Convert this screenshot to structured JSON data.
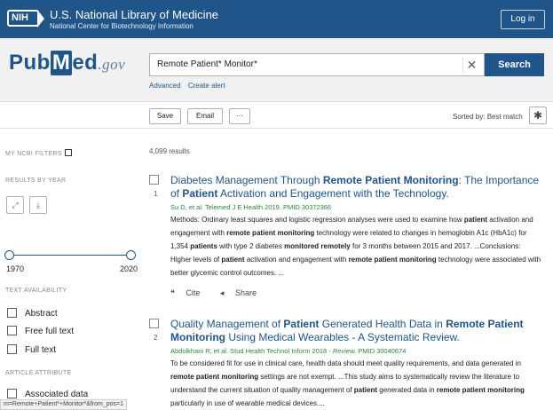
{
  "header": {
    "badge": "NIH",
    "org_title": "U.S. National Library of Medicine",
    "org_subtitle": "National Center for Biotechnology Information",
    "login_label": "Log in"
  },
  "pubmed": {
    "logo_pub": "Pub",
    "logo_m": "M",
    "logo_ed": "ed",
    "logo_gov": ".gov"
  },
  "search": {
    "query": "Remote Patient* Monitor*",
    "clear_glyph": "✕",
    "button_label": "Search",
    "advanced_label": "Advanced",
    "create_alert_label": "Create alert"
  },
  "toolbar": {
    "save_label": "Save",
    "email_label": "Email",
    "more_label": "···",
    "sort_text": "Sorted by: Best match",
    "gear_glyph": "✱"
  },
  "sidebar": {
    "my_filters": "MY NCBI FILTERS",
    "results_by_year": "RESULTS BY YEAR",
    "expand_glyph": "⤢",
    "download_glyph": "⤓",
    "year_start": "1970",
    "year_end": "2020",
    "text_availability": "TEXT AVAILABILITY",
    "abstract": "Abstract",
    "free_full_text": "Free full text",
    "full_text": "Full text",
    "article_attribute": "ARTICLE ATTRIBUTE",
    "associated_data": "Associated data"
  },
  "results": {
    "count_text": "4,099 results",
    "items": [
      {
        "number": "1",
        "title_parts": [
          {
            "t": "Diabetes Management Through ",
            "b": false
          },
          {
            "t": "Remote Patient Monitoring",
            "b": true
          },
          {
            "t": ": The Importance of ",
            "b": false
          },
          {
            "t": "Patient",
            "b": true
          },
          {
            "t": " Activation and Engagement with the Technology.",
            "b": false
          }
        ],
        "citation": "Su D, et al. Telemed J E Health 2019. PMID 30372366",
        "snippet_parts": [
          {
            "t": "Methods: Ordinary least squares and logistic regression analyses were used to examine how ",
            "b": false
          },
          {
            "t": "patient",
            "b": true
          },
          {
            "t": " activation and engagement with ",
            "b": false
          },
          {
            "t": "remote patient monitoring",
            "b": true
          },
          {
            "t": " technology were related to changes in hemoglobin A1c (HbA1c) for 1,354 ",
            "b": false
          },
          {
            "t": "patients",
            "b": true
          },
          {
            "t": " with type 2 diabetes ",
            "b": false
          },
          {
            "t": "monitored remotely",
            "b": true
          },
          {
            "t": " for 3 months between 2015 and 2017. ...Conclusions: Higher levels of ",
            "b": false
          },
          {
            "t": "patient",
            "b": true
          },
          {
            "t": " activation and engagement with ",
            "b": false
          },
          {
            "t": "remote patient monitoring",
            "b": true
          },
          {
            "t": " technology were associated with better glycemic control outcomes. ...",
            "b": false
          }
        ],
        "cite_label": "Cite",
        "share_label": "Share"
      },
      {
        "number": "2",
        "title_parts": [
          {
            "t": "Quality Management of ",
            "b": false
          },
          {
            "t": "Patient",
            "b": true
          },
          {
            "t": " Generated Health Data in ",
            "b": false
          },
          {
            "t": "Remote Patient Monitoring",
            "b": true
          },
          {
            "t": " Using Medical Wearables - A Systematic Review.",
            "b": false
          }
        ],
        "citation": "Abdolkhani R, et al. Stud Health Technol Inform 2018 - ",
        "citation_italic": "Review.",
        "citation_tail": " PMID 30040674",
        "snippet_parts": [
          {
            "t": "To be considered fit for use in clinical care, health data should meet quality requirements, and data generated in ",
            "b": false
          },
          {
            "t": "remote patient monitoring",
            "b": true
          },
          {
            "t": " settings are not exempt. ...This study aims to systematically review the literature to understand the current situation of quality management of ",
            "b": false
          },
          {
            "t": "patient",
            "b": true
          },
          {
            "t": " generated data in ",
            "b": false
          },
          {
            "t": "remote patient monitoring",
            "b": true
          },
          {
            "t": " particularly in use of wearable medical devices....",
            "b": false
          }
        ]
      }
    ]
  },
  "status_bar": {
    "url": "m=Remote+Patient*+Monitor*&from_pos=1"
  }
}
